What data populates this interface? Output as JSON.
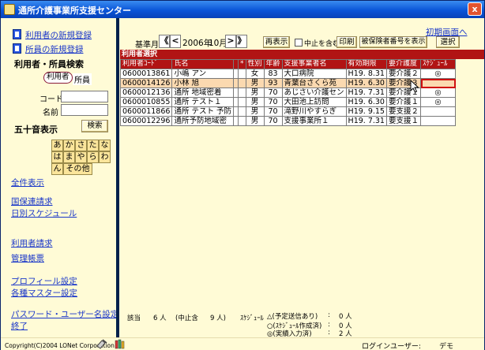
{
  "window": {
    "title": "通所介護事業所支援センター",
    "close_label": "x"
  },
  "sidebar": {
    "links_top": [
      "利用者の新規登録",
      "所員の新規登録"
    ],
    "search_heading": "利用者・所員検索",
    "radio": {
      "selected": "利用者",
      "other": "所員"
    },
    "code_label": "コード",
    "name_label": "名前",
    "kana_heading": "五十音表示",
    "search_button": "検索",
    "kana_rows": [
      [
        "あ",
        "か",
        "さ",
        "た",
        "な"
      ],
      [
        "は",
        "ま",
        "や",
        "ら",
        "わ"
      ]
    ],
    "kana_last": [
      "ん",
      "その他"
    ],
    "menu": [
      "全件表示",
      "国保連請求",
      "日別スケジュール",
      "利用者請求",
      "管理帳票",
      "プロフィール設定",
      "各種マスター設定",
      "パスワード・ユーザー名設定",
      "終了"
    ]
  },
  "toolbar": {
    "home_link": "初期画面へ",
    "base_month_label": "基準月",
    "nav_first": "《",
    "nav_prev": "<",
    "year_text": "2006年",
    "month_text": "10月",
    "nav_next": ">",
    "nav_last": "》",
    "redisplay_button": "再表示",
    "include_stopped_label": "中止を含む",
    "print_button": "印刷",
    "insurance_button": "被保険者番号を表示",
    "select_button": "選択"
  },
  "table": {
    "band_title": "利用者選択",
    "columns": [
      "利用者ｺｰﾄﾞ",
      "氏名",
      "",
      "*",
      "性別",
      "年齢",
      "支援事業者名",
      "有効期限",
      "要介護度",
      "ｽｹｼﾞｭｰﾙ"
    ],
    "rows": [
      [
        "0600013861",
        "小嶋 アン",
        "",
        "",
        "女",
        "83",
        "大口病院",
        "H19. 8.31",
        "要介護２",
        "◎"
      ],
      [
        "0600014126",
        "小林 旭",
        "",
        "",
        "男",
        "93",
        "青葉台さくら苑",
        "H19. 6.30",
        "要介護３",
        ""
      ],
      [
        "0600012136",
        "通所 地域密着",
        "",
        "",
        "男",
        "70",
        "あじさい介護セン",
        "H19. 7.31",
        "要介護１",
        "◎"
      ],
      [
        "0600010855",
        "通所 テスト１",
        "",
        "",
        "男",
        "70",
        "大田池上訪問",
        "H19. 6.30",
        "要介護１",
        "◎"
      ],
      [
        "0600011866",
        "通所 テスト 予防",
        "",
        "",
        "男",
        "70",
        "滝野川やすらぎ",
        "H19. 9.15",
        "要支援２",
        ""
      ],
      [
        "0600012296",
        "通所予防地域密",
        "",
        "",
        "男",
        "70",
        "支援事業所１",
        "H19. 7.31",
        "要支援１",
        ""
      ]
    ],
    "selected_row": 1
  },
  "status": {
    "count_label": "該当",
    "count_value": "6 人",
    "stopped_text": "(中止含",
    "stopped_value": "9 人)",
    "schedule_label": "ｽｹｼﾞｭｰﾙ",
    "legend": [
      {
        "text": "△(予定送信あり)",
        "colon": ":",
        "value": "0 人"
      },
      {
        "text": "○(ｽｹｼﾞｭｰﾙ作成済)",
        "colon": ":",
        "value": "0 人"
      },
      {
        "text": "◎(実績入力済)",
        "colon": ":",
        "value": "2 人"
      }
    ]
  },
  "footer": {
    "copyright": "Copyright(C)2004 LONet Corporation",
    "login_label": "ログインユーザー:",
    "login_user": "デモ"
  }
}
